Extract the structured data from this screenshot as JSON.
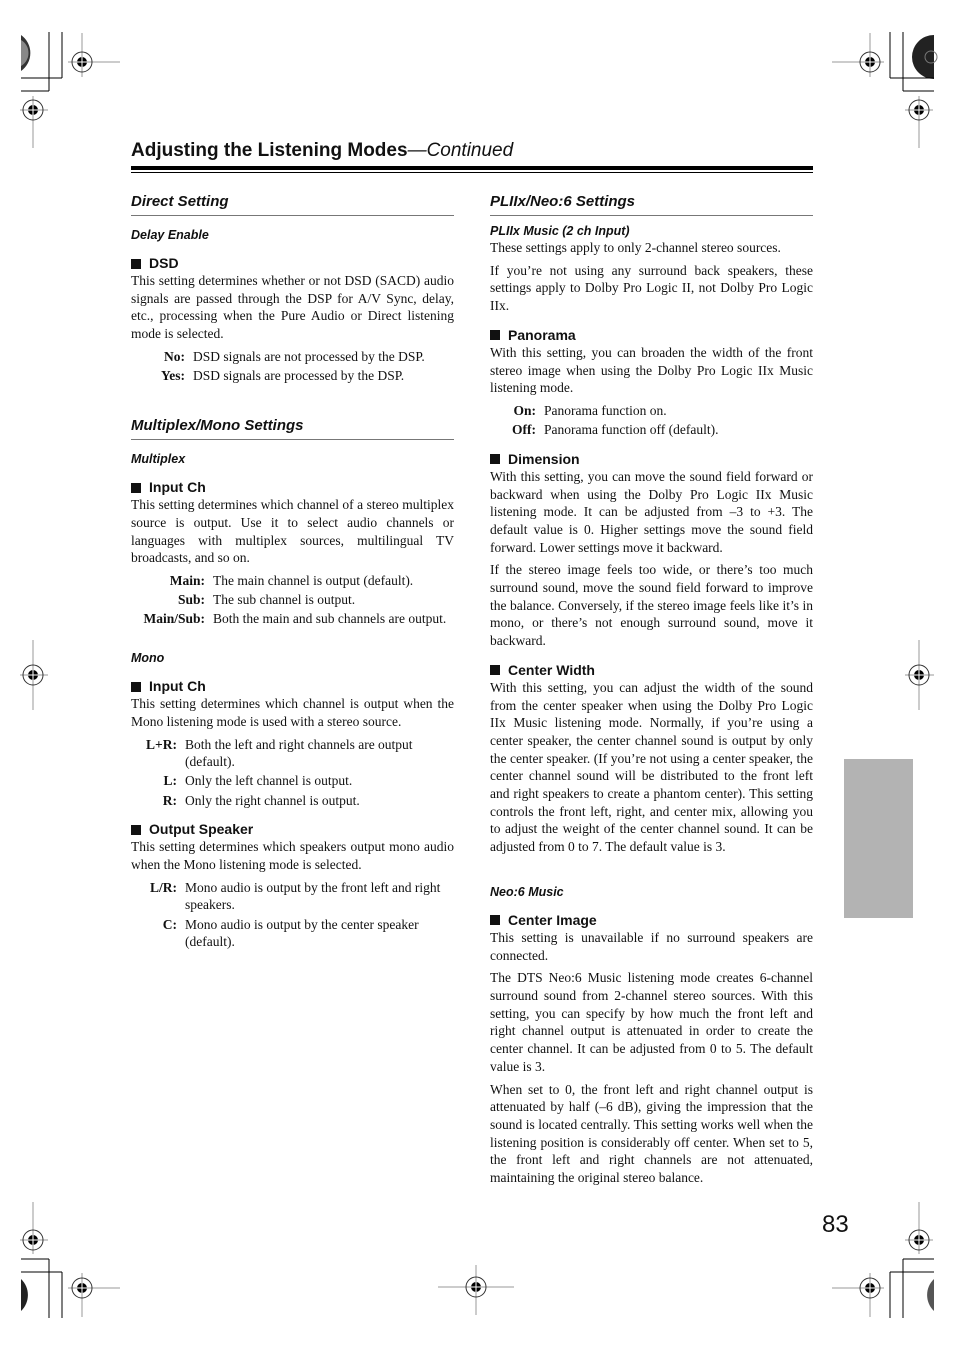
{
  "header": {
    "title": "Adjusting the Listening Modes",
    "continued": "—Continued"
  },
  "left_column": {
    "direct_setting": {
      "title": "Direct Setting",
      "subsection": "Delay Enable",
      "item": {
        "heading": "DSD",
        "paragraphs": [
          "This setting determines whether or not DSD (SACD) audio signals are passed through the DSP for A/V Sync, delay, etc., processing when the Pure Audio or Direct listening mode is selected."
        ],
        "options": [
          {
            "key": "No:",
            "text": "DSD signals are not processed by the DSP."
          },
          {
            "key": "Yes:",
            "text": "DSD signals are processed by the DSP."
          }
        ]
      }
    },
    "multiplex_mono": {
      "title": "Multiplex/Mono Settings",
      "multiplex": {
        "subsection": "Multiplex",
        "item": {
          "heading": "Input Ch",
          "paragraphs": [
            "This setting determines which channel of a stereo multiplex source is output. Use it to select audio channels or languages with multiplex sources, multilingual TV broadcasts, and so on."
          ],
          "options": [
            {
              "key": "Main:",
              "text": "The main channel is output (default)."
            },
            {
              "key": "Sub:",
              "text": "The sub channel is output."
            },
            {
              "key": "Main/Sub:",
              "text": "Both the main and sub channels are output."
            }
          ]
        }
      },
      "mono": {
        "subsection": "Mono",
        "input_ch": {
          "heading": "Input Ch",
          "paragraphs": [
            "This setting determines which channel is output when the Mono listening mode is used with a stereo source."
          ],
          "options": [
            {
              "key": "L+R:",
              "text": "Both the left and right channels are output (default)."
            },
            {
              "key": "L:",
              "text": "Only the left channel is output."
            },
            {
              "key": "R:",
              "text": "Only the right channel is output."
            }
          ]
        },
        "output_speaker": {
          "heading": "Output Speaker",
          "paragraphs": [
            "This setting determines which speakers output mono audio when the Mono listening mode is selected."
          ],
          "options": [
            {
              "key": "L/R:",
              "text": "Mono audio is output by the front left and right speakers."
            },
            {
              "key": "C:",
              "text": "Mono audio is output by the center speaker (default)."
            }
          ]
        }
      }
    }
  },
  "right_column": {
    "title": "PLIIx/Neo:6 Settings",
    "plIIx_music": {
      "subsection": "PLIIx Music (2 ch Input)",
      "intro": [
        "These settings apply to only 2-channel stereo sources.",
        "If you’re not using any surround back speakers, these settings apply to Dolby Pro Logic II, not Dolby Pro Logic IIx."
      ],
      "panorama": {
        "heading": "Panorama",
        "paragraphs": [
          "With this setting, you can broaden the width of the front stereo image when using the Dolby Pro Logic IIx Music listening mode."
        ],
        "options": [
          {
            "key": "On:",
            "text": "Panorama function on."
          },
          {
            "key": "Off:",
            "text": "Panorama function off (default)."
          }
        ]
      },
      "dimension": {
        "heading": "Dimension",
        "paragraphs": [
          "With this setting, you can move the sound field forward or backward when using the Dolby Pro Logic IIx Music listening mode. It can be adjusted from –3 to +3. The default value is 0. Higher settings move the sound field forward. Lower settings move it backward.",
          "If the stereo image feels too wide, or there’s too much surround sound, move the sound field forward to improve the balance. Conversely, if the stereo image feels like it’s in mono, or there’s not enough surround sound, move it backward."
        ]
      },
      "center_width": {
        "heading": "Center Width",
        "paragraphs": [
          "With this setting, you can adjust the width of the sound from the center speaker when using the Dolby Pro Logic IIx Music listening mode. Normally, if you’re using a center speaker, the center channel sound is output by only the center speaker. (If you’re not using a center speaker, the center channel sound will be distributed to the front left and right speakers to create a phantom center). This setting controls the front left, right, and center mix, allowing you to adjust the weight of the center channel sound. It can be adjusted from 0 to 7. The default value is 3."
        ]
      }
    },
    "neo6_music": {
      "subsection": "Neo:6 Music",
      "center_image": {
        "heading": "Center Image",
        "paragraphs": [
          "This setting is unavailable if no surround speakers are connected.",
          "The DTS Neo:6 Music listening mode creates 6-channel surround sound from 2-channel stereo sources. With this setting, you can specify by how much the front left and right channel output is attenuated in order to create the center channel. It can be adjusted from 0 to 5. The default value is 3.",
          "When set to 0, the front left and right channel output is attenuated by half (–6 dB), giving the impression that the sound is located centrally. This setting works well when the listening position is considerably off center. When set to 5, the front left and right channels are not attenuated, maintaining the original stereo balance."
        ]
      }
    }
  },
  "page_number": "83",
  "colors": {
    "text": "#111111",
    "section_rule": "#777777",
    "side_tab": "#b3b3b3"
  }
}
